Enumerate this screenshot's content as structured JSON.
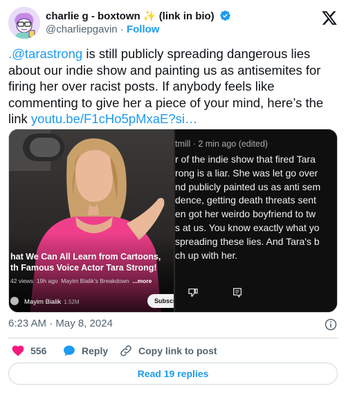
{
  "author": {
    "display_name": "charlie g - boxtown ✨ (link in bio)",
    "handle": "@charliepgavin",
    "separator": "·",
    "follow_label": "Follow"
  },
  "tweet": {
    "mention": ".@tarastrong",
    "text": " is still publicly spreading dangerous lies about our indie show and painting us as antisemites for firing her over racist posts. If anybody feels like commenting to give her a piece of your mind, here’s the link ",
    "link": "youtu.be/F1cHo5pMxaE?si…"
  },
  "video": {
    "title_line1": "hat We Can All Learn from Cartoons,",
    "title_line2": "th Famous Voice Actor Tara Strong!",
    "meta_views": "42 views",
    "meta_age": "19h ago",
    "meta_channel_tag": "Mayim Bialik's Breakdown",
    "meta_more": "...more",
    "channel_name": "Mayim Bialik",
    "subscribers": "1.52M",
    "subscribe_label": "Subscrib"
  },
  "comment": {
    "header": "tmill · 2 min ago (edited)",
    "lines": [
      "r of the indie show that fired Tara",
      "rong is a liar. She was let go over",
      "nd publicly painted us as anti sem",
      "dence, getting death threats sent",
      "en got her weirdo boyfriend to tw",
      "s at us. You know exactly what yo",
      "spreading these lies. And Tara's b",
      "ch up with her."
    ]
  },
  "footer": {
    "timestamp": "6:23 AM · May 8, 2024",
    "like_count": "556",
    "reply_label": "Reply",
    "copy_label": "Copy link to post",
    "read_replies_label": "Read 19 replies"
  },
  "colors": {
    "accent": "#1d9bf0",
    "like": "#f91880",
    "secondary_text": "#536471",
    "border": "#cfd9de"
  },
  "icons": [
    "avatar",
    "verified-badge-icon",
    "x-logo-icon",
    "dislike-icon",
    "comment-reply-icon",
    "info-icon",
    "heart-icon",
    "reply-bubble-icon",
    "link-icon"
  ]
}
